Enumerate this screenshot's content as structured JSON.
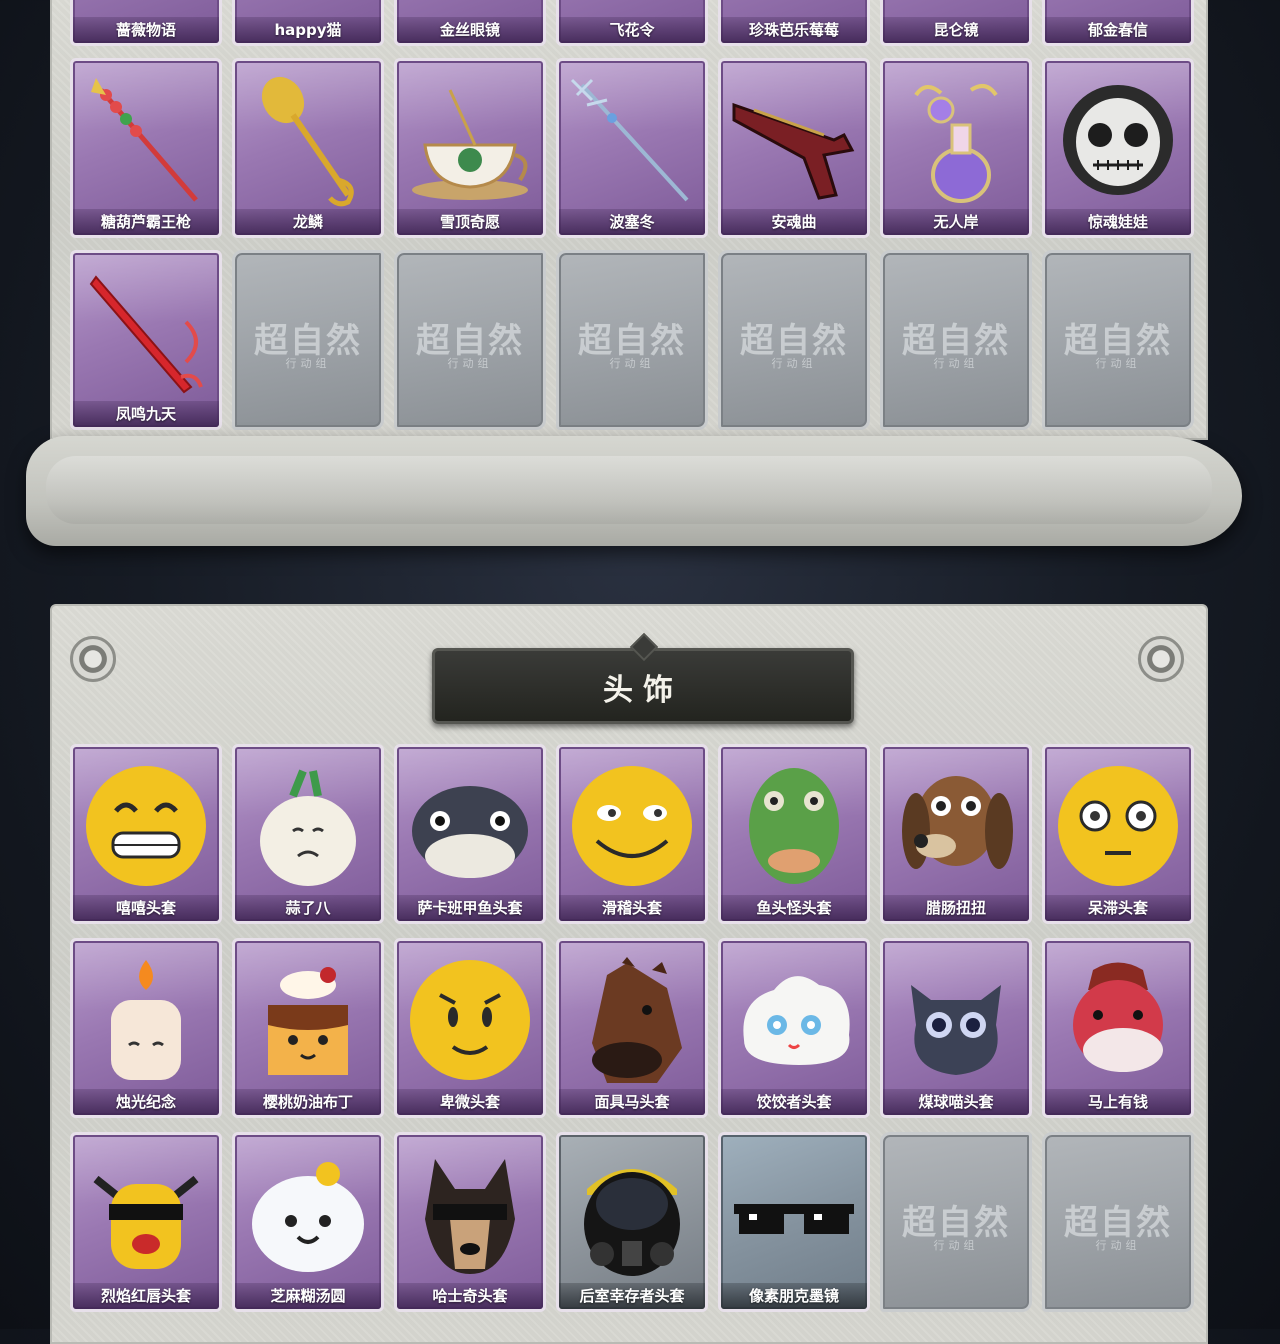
{
  "top_section": {
    "row1": [
      {
        "label": "蔷薇物语"
      },
      {
        "label": "happy猫"
      },
      {
        "label": "金丝眼镜"
      },
      {
        "label": "飞花令"
      },
      {
        "label": "珍珠芭乐莓莓"
      },
      {
        "label": "昆仑镜"
      },
      {
        "label": "郁金春信"
      }
    ],
    "row2": [
      {
        "label": "糖葫芦霸王枪"
      },
      {
        "label": "龙鳞"
      },
      {
        "label": "雪顶奇愿"
      },
      {
        "label": "波塞冬"
      },
      {
        "label": "安魂曲"
      },
      {
        "label": "无人岸"
      },
      {
        "label": "惊魂娃娃"
      }
    ],
    "row3_first": {
      "label": "凤鸣九天"
    },
    "placeholder": {
      "title": "超自然",
      "subtitle": "行动组"
    }
  },
  "headwear_section": {
    "title": "头饰",
    "row1": [
      {
        "label": "嘻嘻头套"
      },
      {
        "label": "蒜了八"
      },
      {
        "label": "萨卡班甲鱼头套"
      },
      {
        "label": "滑稽头套"
      },
      {
        "label": "鱼头怪头套"
      },
      {
        "label": "腊肠扭扭"
      },
      {
        "label": "呆滞头套"
      }
    ],
    "row2": [
      {
        "label": "烛光纪念"
      },
      {
        "label": "樱桃奶油布丁"
      },
      {
        "label": "卑微头套"
      },
      {
        "label": "面具马头套"
      },
      {
        "label": "饺饺者头套"
      },
      {
        "label": "煤球喵头套"
      },
      {
        "label": "马上有钱"
      }
    ],
    "row3": [
      {
        "label": "烈焰红唇头套"
      },
      {
        "label": "芝麻糊汤圆"
      },
      {
        "label": "哈士奇头套"
      },
      {
        "label": "后室幸存者头套"
      },
      {
        "label": "像素朋克墨镜"
      }
    ],
    "placeholder": {
      "title": "超自然",
      "subtitle": "行动组"
    }
  }
}
